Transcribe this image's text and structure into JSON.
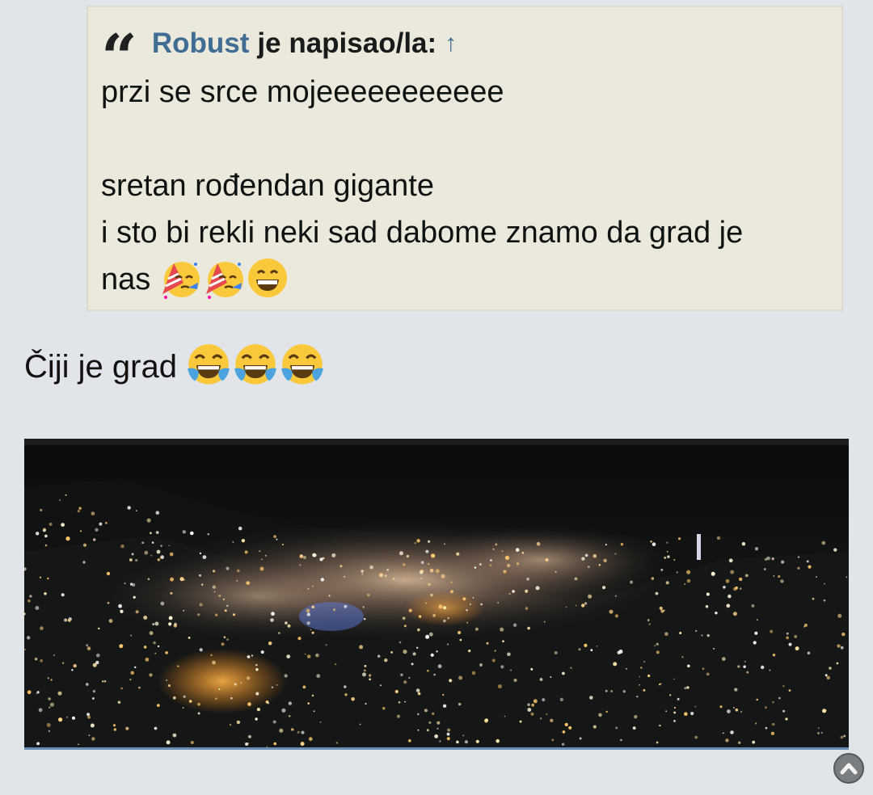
{
  "quote": {
    "author": "Robust",
    "wrote_label": "je napisao/la:",
    "jump_arrow": "↑",
    "lines": [
      "przi se srce mojeeeeeeeeeee",
      "",
      "sretan rođendan gigante",
      "i sto bi rekli neki sad dabome znamo da grad je",
      "nas"
    ],
    "emojis": [
      "partying-face-emoji",
      "partying-face-emoji",
      "grinning-face-emoji"
    ]
  },
  "post": {
    "text": "Čiji je grad",
    "emojis": [
      "tears-of-joy-emoji",
      "tears-of-joy-emoji",
      "tears-of-joy-emoji"
    ]
  },
  "image": {
    "subject": "night-city-fireworks-photo"
  },
  "colors": {
    "background": "#e1e4e9",
    "quote_background": "#ebe9dc",
    "author_link": "#3f6d93",
    "image_underline": "#6a8bb3"
  },
  "icons": {
    "quote": "quote-icon",
    "scroll_top": "chevron-up-circle-icon"
  }
}
